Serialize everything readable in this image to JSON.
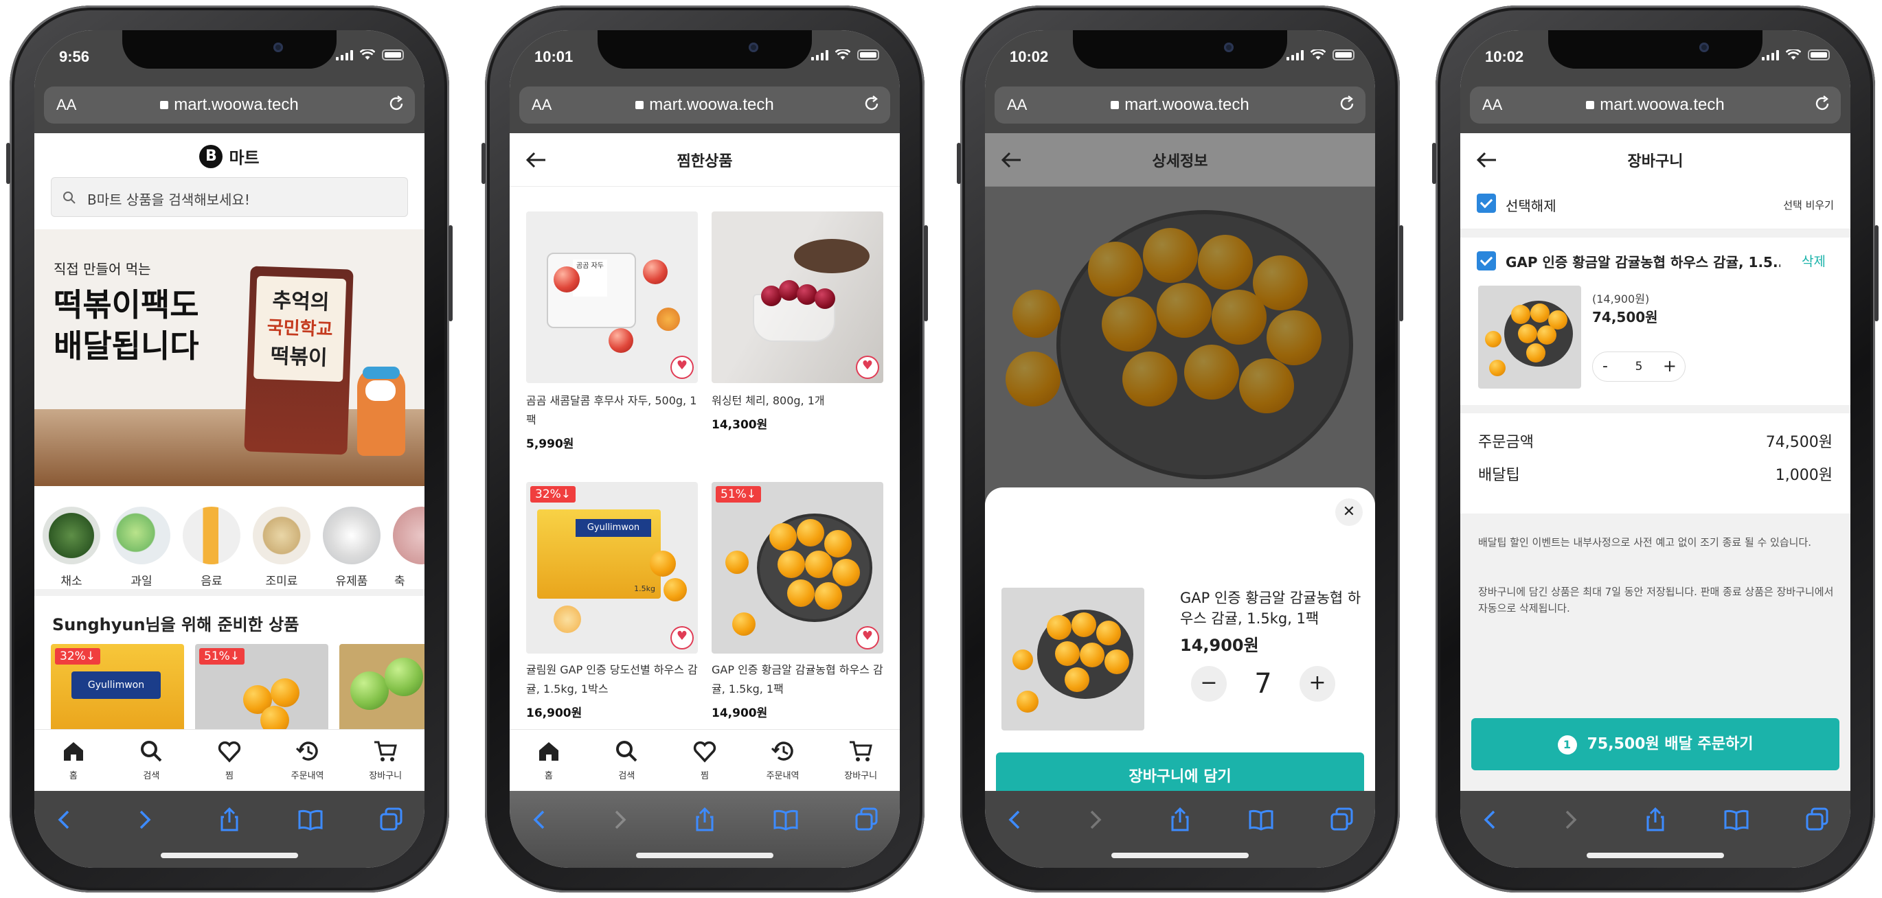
{
  "url": "mart.woowa.tech",
  "aa_label": "AA",
  "phones": [
    {
      "time": "9:56"
    },
    {
      "time": "10:01"
    },
    {
      "time": "10:02"
    },
    {
      "time": "10:02"
    }
  ],
  "tabbar": [
    {
      "label": "홈",
      "icon": "home-icon"
    },
    {
      "label": "검색",
      "icon": "search-icon"
    },
    {
      "label": "찜",
      "icon": "heart-icon"
    },
    {
      "label": "주문내역",
      "icon": "history-icon"
    },
    {
      "label": "장바구니",
      "icon": "cart-icon"
    }
  ],
  "home": {
    "logo_letter": "B",
    "logo_text": "마트",
    "search_placeholder": "B마트 상품을 검색해보세요!",
    "banner": {
      "subtitle": "직접 만들어 먹는",
      "title_line1": "떡볶이팩도",
      "title_line2": "배달됩니다",
      "pack_line1": "추억의",
      "pack_line2": "국민학교",
      "pack_line3": "떡볶이"
    },
    "categories": [
      "채소",
      "과일",
      "음료",
      "조미료",
      "유제품",
      "축"
    ],
    "recommend_user": "Sunghyun",
    "recommend_suffix": "님을 위해 준비한 상품",
    "recommend_badges": [
      "32%↓",
      "51%↓"
    ],
    "gyullimwon_label": "Gyullimwon"
  },
  "wishlist": {
    "title": "찜한상품",
    "items": [
      {
        "name": "곰곰 새콤달콤 후무사 자두, 500g, 1팩",
        "price": "5,990원",
        "badge": ""
      },
      {
        "name": "워싱턴 체리, 800g, 1개",
        "price": "14,300원",
        "badge": ""
      },
      {
        "name": "귤림원 GAP 인증 당도선별 하우스 감귤, 1.5kg, 1박스",
        "price": "16,900원",
        "badge": "32%↓"
      },
      {
        "name": "GAP 인증 황금알 감귤농협 하우스 감귤, 1.5kg, 1팩",
        "price": "14,900원",
        "badge": "51%↓"
      }
    ],
    "plum_pack_label": "곰곰 자두",
    "gyullimwon_label": "Gyullimwon",
    "box_weight": "1.5kg"
  },
  "detail": {
    "title": "상세정보",
    "product_name": "GAP 인증 황금알 감귤농협 하우스 감귤, 1.5kg, 1팩",
    "price": "14,900원",
    "quantity": "7",
    "minus": "−",
    "plus": "+",
    "close": "✕",
    "add_button": "장바구니에 담기"
  },
  "cart": {
    "title": "장바구니",
    "deselect_label": "선택해제",
    "clear_label": "선택 비우기",
    "item_name": "GAP 인증 황금알 감귤농협 하우스 감귤, 1.5...",
    "delete_label": "삭제",
    "unit_price": "(14,900원)",
    "total_price": "74,500원",
    "quantity": "5",
    "minus": "-",
    "plus": "+",
    "order_amount_label": "주문금액",
    "order_amount": "74,500원",
    "delivery_tip_label": "배달팁",
    "delivery_tip": "1,000원",
    "notice_1": "배달팁 할인 이벤트는 내부사정으로 사전 예고 없이 조기 종료 될 수 있습니다.",
    "notice_2": "장바구니에 담긴 상품은 최대 7일 동안 저장됩니다. 판매 종료 상품은 장바구니에서 자동으로 삭제됩니다.",
    "order_count": "1",
    "order_button": "75,500원 배달 주문하기"
  },
  "colors": {
    "accent": "#1bb3aa",
    "check": "#2a86dc",
    "discount": "#f03e3e",
    "safari_bar": "#454545"
  }
}
